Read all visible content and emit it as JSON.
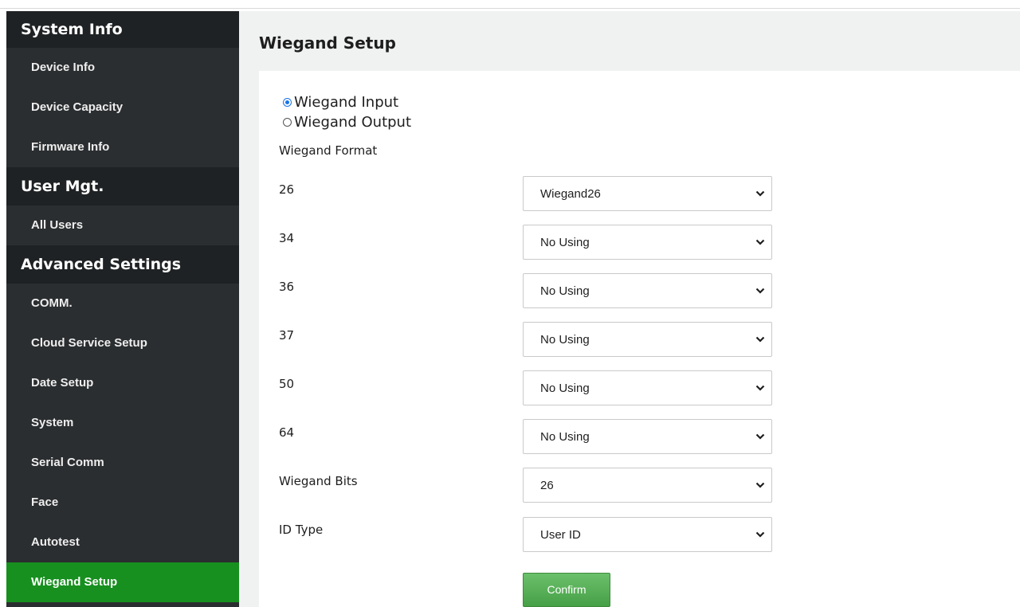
{
  "sidebar": {
    "sections": [
      {
        "title": "System Info",
        "items": [
          "Device Info",
          "Device Capacity",
          "Firmware Info"
        ]
      },
      {
        "title": "User Mgt.",
        "items": [
          "All Users"
        ]
      },
      {
        "title": "Advanced Settings",
        "items": [
          "COMM.",
          "Cloud Service Setup",
          "Date Setup",
          "System",
          "Serial Comm",
          "Face",
          "Autotest",
          "Wiegand Setup"
        ]
      }
    ],
    "active_item": "Wiegand Setup",
    "active_color": "#17901f"
  },
  "page": {
    "title": "Wiegand Setup"
  },
  "form": {
    "mode_options": [
      {
        "label": "Wiegand Input",
        "checked": true
      },
      {
        "label": "Wiegand Output",
        "checked": false
      }
    ],
    "format_heading": "Wiegand Format",
    "rows": [
      {
        "label": "26",
        "value": "Wiegand26"
      },
      {
        "label": "34",
        "value": "No Using"
      },
      {
        "label": "36",
        "value": "No Using"
      },
      {
        "label": "37",
        "value": "No Using"
      },
      {
        "label": "50",
        "value": "No Using"
      },
      {
        "label": "64",
        "value": "No Using"
      },
      {
        "label": "Wiegand Bits",
        "value": "26"
      },
      {
        "label": "ID Type",
        "value": "User ID"
      }
    ],
    "confirm_label": "Confirm",
    "chevron_icon": "chevron-down-icon"
  },
  "colors": {
    "sidebar_bg": "#2b2e30",
    "sidebar_header_bg": "#1f2224",
    "main_bg": "#f0f2f2",
    "radio_accent": "#1a73e8",
    "confirm_button": "#52a852"
  }
}
